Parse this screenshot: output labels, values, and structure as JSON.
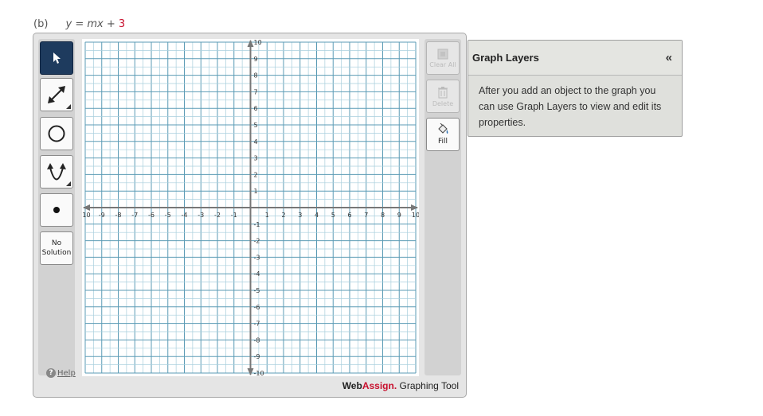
{
  "problem": {
    "part": "(b)",
    "equation_main": "y = mx +",
    "equation_const": "3"
  },
  "tools": {
    "pointer_icon": "arrow-pointer-icon",
    "line_icon": "double-arrow-line-icon",
    "circle_icon": "circle-icon",
    "parabola_icon": "parabola-icon",
    "point_icon": "point-icon",
    "no_solution_line1": "No",
    "no_solution_line2": "Solution",
    "help_label": "Help"
  },
  "right_tools": {
    "clear_all": "Clear All",
    "delete": "Delete",
    "fill": "Fill"
  },
  "grid": {
    "x_min": -10,
    "x_max": 10,
    "y_min": -10,
    "y_max": 10,
    "minor_step": 0.5,
    "major_step": 1,
    "x_ticks": [
      "-10",
      "-9",
      "-8",
      "-7",
      "-6",
      "-5",
      "-4",
      "-3",
      "-2",
      "-1",
      "1",
      "2",
      "3",
      "4",
      "5",
      "6",
      "7",
      "8",
      "9",
      "10"
    ],
    "y_ticks": [
      "10",
      "9",
      "8",
      "7",
      "6",
      "5",
      "4",
      "3",
      "2",
      "1",
      "-1",
      "-2",
      "-3",
      "-4",
      "-5",
      "-6",
      "-7",
      "-8",
      "-9",
      "-10"
    ]
  },
  "brand": {
    "web": "Web",
    "assign": "Assign.",
    "tool": " Graphing Tool"
  },
  "layers_panel": {
    "title": "Graph Layers",
    "collapse": "«",
    "body": "After you add an object to the graph you can use Graph Layers to view and edit its properties."
  },
  "colors": {
    "accent_red": "#c8102e",
    "active_tool": "#1e3b5e",
    "grid_major": "#5b9bb5",
    "grid_minor": "#a9cfdd"
  }
}
